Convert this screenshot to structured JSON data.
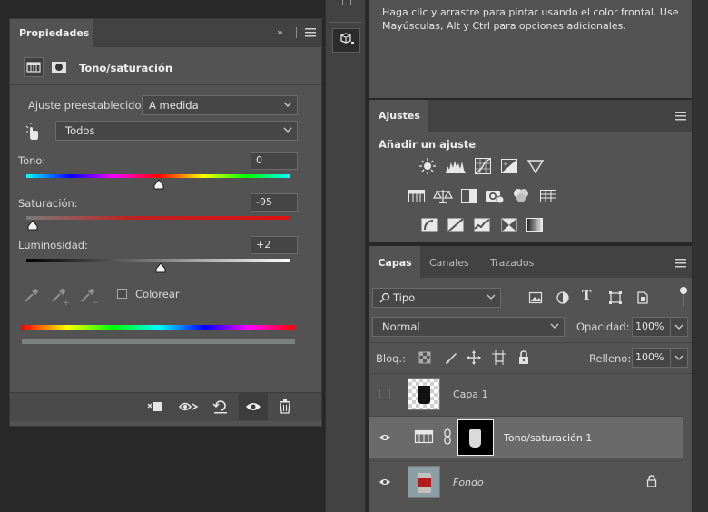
{
  "properties": {
    "tab_label": "Propiedades",
    "adjustment_title": "Tono/saturación",
    "preset_label": "Ajuste preestablecido:",
    "preset_value": "A medida",
    "channel_value": "Todos",
    "hue_label": "Tono:",
    "hue_value": "0",
    "saturation_label": "Saturación:",
    "saturation_value": "-95",
    "lightness_label": "Luminosidad:",
    "lightness_value": "+2",
    "hue_slider_level": 0.5,
    "saturation_slider_level": 0.025,
    "lightness_slider_level": 0.51,
    "colorize_label": "Colorear"
  },
  "hint": {
    "text": "Haga clic y arrastre para pintar usando el color frontal. Use Mayúsculas, Alt y Ctrl para opciones adicionales."
  },
  "adjustments": {
    "tab_label": "Ajustes",
    "add_label": "Añadir un ajuste"
  },
  "layers_panel": {
    "tabs": [
      "Capas",
      "Canales",
      "Trazados"
    ],
    "filter_value": "Tipo",
    "blend_mode": "Normal",
    "opacity_label": "Opacidad:",
    "opacity_value": "100%",
    "lock_label": "Bloq.:",
    "fill_label": "Relleno:",
    "fill_value": "100%",
    "layers": [
      {
        "name": "Capa 1"
      },
      {
        "name": "Tono/saturación 1"
      },
      {
        "name": "Fondo"
      }
    ]
  },
  "colors": {
    "panel_bg": "#535353",
    "dark_bg": "#282828",
    "selected_row": "#6a6a6a",
    "hue_gradient": [
      "#ff0000",
      "#ffff00",
      "#00ff00",
      "#00ffff",
      "#0000ff",
      "#ff00ff",
      "#ff0000"
    ]
  },
  "icons": [
    "clip-to-layer-icon",
    "view-previous-state-icon",
    "reset-icon",
    "visibility-icon",
    "delete-icon",
    "eyedropper-icon",
    "eyedropper-add-icon",
    "eyedropper-subtract-icon",
    "on-image-adjust-icon",
    "brightness-icon",
    "levels-icon",
    "curves-icon",
    "exposure-icon",
    "vibrance-icon",
    "hue-saturation-icon",
    "color-balance-icon",
    "black-white-icon",
    "photo-filter-icon",
    "channel-mixer-icon",
    "color-lookup-icon",
    "invert-icon",
    "posterize-icon",
    "threshold-icon",
    "selective-color-icon",
    "gradient-map-icon",
    "lock-icon",
    "link-icon",
    "eye-icon",
    "panel-menu-icon"
  ]
}
